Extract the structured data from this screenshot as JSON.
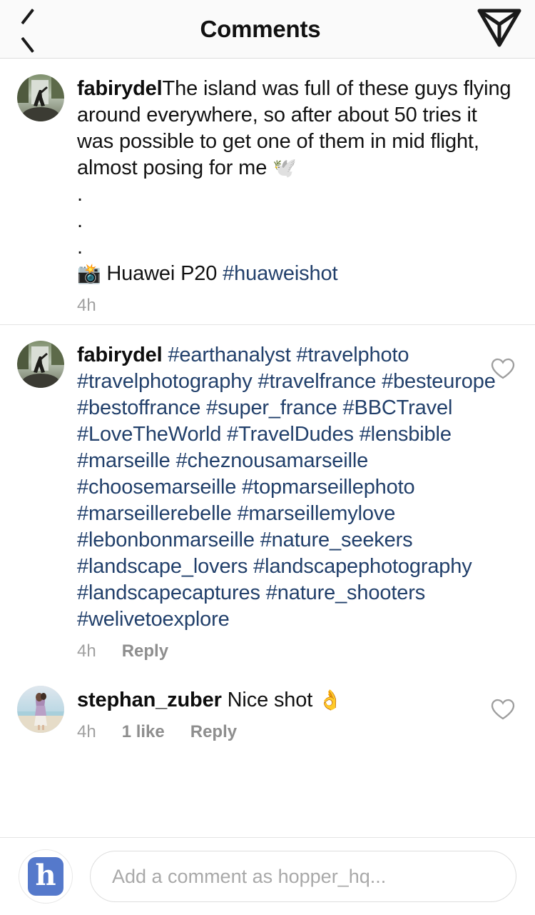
{
  "header": {
    "title": "Comments",
    "back_icon": "chevron-left-icon",
    "share_icon": "paper-plane-icon"
  },
  "comments": [
    {
      "username": "fabirydel",
      "avatar_alt": "fabirydel-avatar",
      "text": "The island was full of these guys flying around everywhere, so after about 50 tries it was possible to get one of them in mid flight, almost posing for me ",
      "emoji": "🕊️",
      "dot_lines": [
        ".",
        ".",
        "."
      ],
      "tail_emoji": "📸",
      "tail_text": "Huawei P20 ",
      "tail_hashtag": "#huaweishot",
      "time": "4h",
      "has_reply": false,
      "has_like_icon": false,
      "likes": ""
    },
    {
      "username": "fabirydel",
      "avatar_alt": "fabirydel-avatar",
      "hashtags": "#earthanalyst #travelphoto #travelphotography #travelfrance #besteurope #bestoffrance #super_france #BBCTravel #LoveTheWorld #TravelDudes #lensbible #marseille #cheznousamarseille #choosemarseille #topmarseillephoto #marseillerebelle #marseillemylove #lebonbonmarseille #nature_seekers #landscape_lovers #landscapephotography #landscapecaptures #nature_shooters #welivetoexplore",
      "time": "4h",
      "reply_label": "Reply",
      "has_reply": true,
      "has_like_icon": true,
      "likes": ""
    },
    {
      "username": "stephan_zuber",
      "avatar_alt": "stephan-zuber-avatar",
      "text": "Nice shot ",
      "emoji": "👌",
      "time": "4h",
      "likes": "1 like",
      "reply_label": "Reply",
      "has_reply": true,
      "has_like_icon": true
    }
  ],
  "composer": {
    "avatar_letter": "h",
    "avatar_name": "hopper-hq-logo",
    "placeholder": "Add a comment as hopper_hq...",
    "value": ""
  },
  "colors": {
    "hashtag": "#22406b",
    "text": "#121212",
    "meta": "#8e8e8e",
    "time": "#a0a0a0",
    "brand_blue": "#5579cb",
    "header_bg": "#fafafa"
  }
}
